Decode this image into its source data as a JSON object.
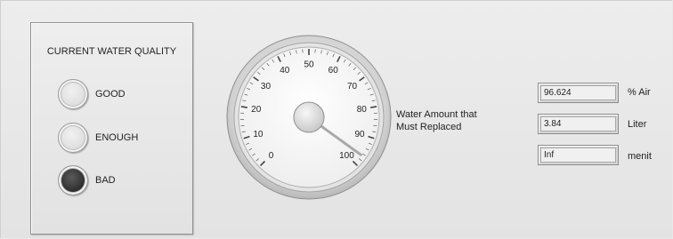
{
  "quality_panel": {
    "title": "CURRENT WATER QUALITY",
    "indicators": [
      {
        "label": "GOOD",
        "state": "off"
      },
      {
        "label": "ENOUGH",
        "state": "off"
      },
      {
        "label": "BAD",
        "state": "on"
      }
    ]
  },
  "gauge": {
    "caption_line1": "Water Amount that",
    "caption_line2": "Must Replaced",
    "min": 0,
    "max": 100,
    "tick_labels": [
      "0",
      "10",
      "20",
      "30",
      "40",
      "50",
      "60",
      "70",
      "80",
      "90",
      "100"
    ],
    "value": 96.624
  },
  "readouts": [
    {
      "value": "96.624",
      "unit": "% Air"
    },
    {
      "value": "3.84",
      "unit": "Liter"
    },
    {
      "value": "Inf",
      "unit": "menit"
    }
  ],
  "colors": {
    "led_off": "#dcdcdc",
    "led_on": "#2e2e2e",
    "needle": "#a9a9a9"
  }
}
